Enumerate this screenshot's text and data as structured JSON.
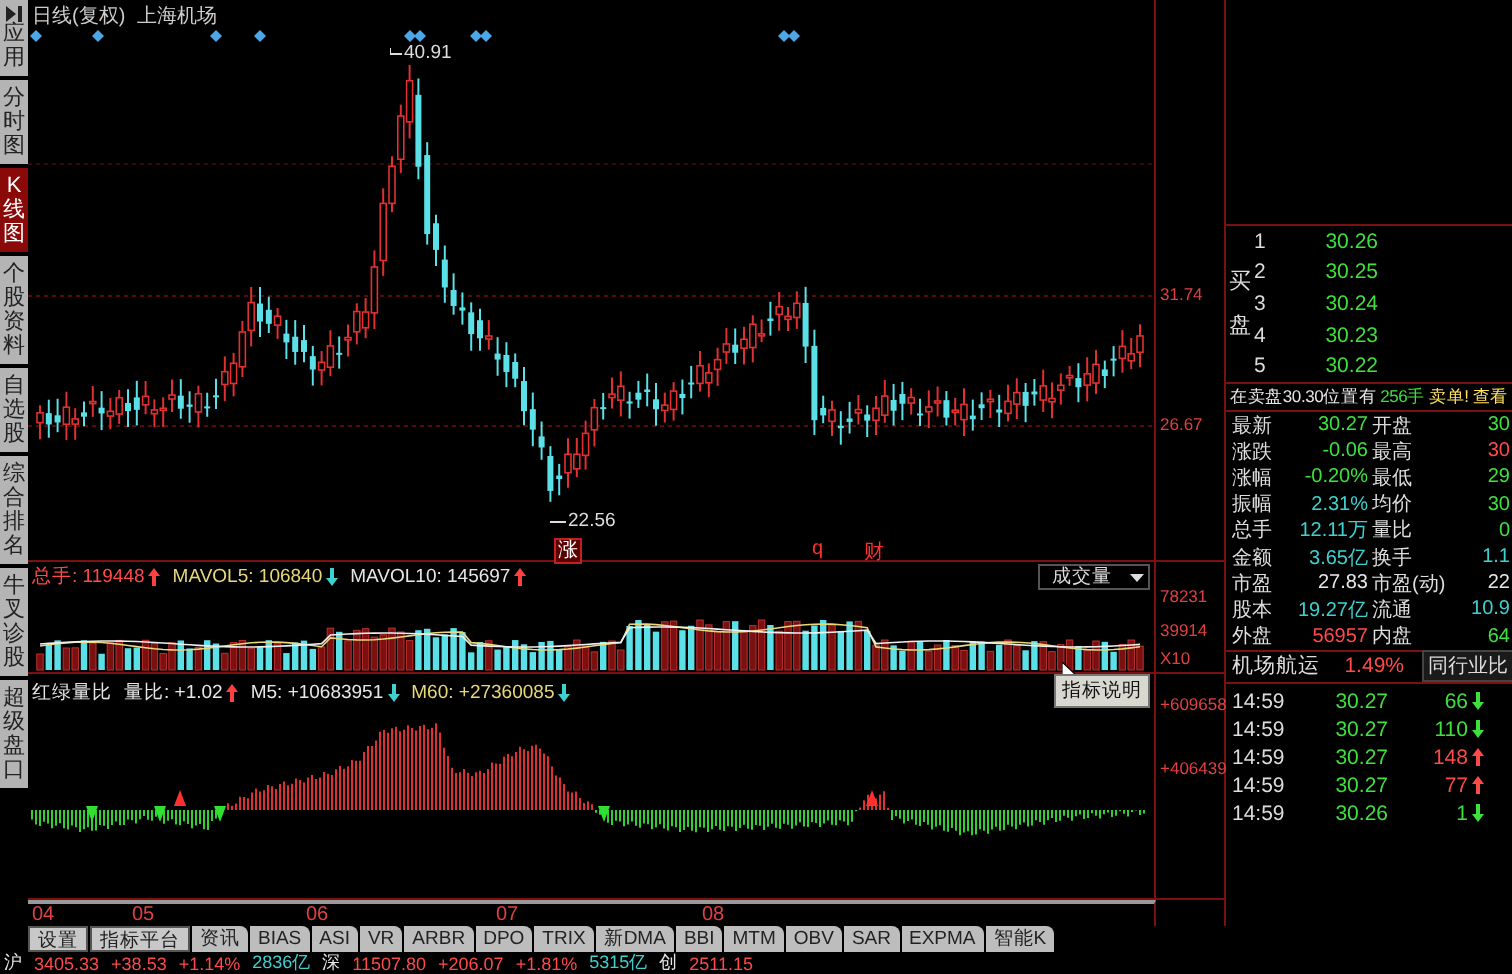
{
  "sidebar": {
    "items": [
      {
        "label": "应用",
        "selected": false,
        "kind": "menu"
      },
      {
        "label": "分时图",
        "selected": false,
        "kind": "tab"
      },
      {
        "label": "K线图",
        "selected": true,
        "kind": "tab"
      },
      {
        "label": "个股资料",
        "selected": false,
        "kind": "tab"
      },
      {
        "label": "自选股",
        "selected": false,
        "kind": "tab"
      },
      {
        "label": "综合排名",
        "selected": false,
        "kind": "tab"
      },
      {
        "label": "牛叉诊股",
        "selected": false,
        "kind": "tab"
      },
      {
        "label": "超级盘口",
        "selected": false,
        "kind": "tab"
      }
    ]
  },
  "kline": {
    "period": "日线(复权)",
    "stock": "上海机场",
    "high_label": "40.91",
    "low_label": "22.56",
    "event_marks": [
      "涨",
      "q",
      "财"
    ],
    "axis_labels": [
      "31.74",
      "26.67"
    ]
  },
  "volume": {
    "metrics": [
      {
        "label": "总手:",
        "value": "119448",
        "rising": true,
        "color": "#ff4a4a"
      },
      {
        "label": "MAVOL5:",
        "value": "106840",
        "rising": false,
        "color": "#e8d87a"
      },
      {
        "label": "MAVOL10:",
        "value": "145697",
        "rising": true,
        "color": "#e6e6e6"
      }
    ],
    "selector": "成交量",
    "axis_labels": [
      "78231",
      "39914",
      "X10"
    ],
    "tooltip": "指标说明"
  },
  "indicator": {
    "name": "红绿量比",
    "metrics": [
      {
        "label": "量比:",
        "value": "+1.02",
        "rising": true,
        "color": "#e6e6e6"
      },
      {
        "label": "M5:",
        "value": "+10683951",
        "rising": false,
        "color": "#e6e6e6"
      },
      {
        "label": "M60:",
        "value": "+27360085",
        "rising": false,
        "color": "#e8d87a"
      }
    ],
    "axis_labels": [
      "+609658",
      "+406439"
    ]
  },
  "date_axis": [
    "04",
    "05",
    "06",
    "07",
    "08"
  ],
  "tabs": [
    {
      "label": "设置",
      "kind": "button"
    },
    {
      "label": "指标平台",
      "kind": "button"
    },
    {
      "label": "资讯",
      "kind": "tab"
    },
    {
      "label": "BIAS",
      "kind": "tab"
    },
    {
      "label": "ASI",
      "kind": "tab"
    },
    {
      "label": "VR",
      "kind": "tab"
    },
    {
      "label": "ARBR",
      "kind": "tab"
    },
    {
      "label": "DPO",
      "kind": "tab"
    },
    {
      "label": "TRIX",
      "kind": "tab"
    },
    {
      "label": "新DMA",
      "kind": "tab"
    },
    {
      "label": "BBI",
      "kind": "tab"
    },
    {
      "label": "MTM",
      "kind": "tab"
    },
    {
      "label": "OBV",
      "kind": "tab"
    },
    {
      "label": "SAR",
      "kind": "tab"
    },
    {
      "label": "EXPMA",
      "kind": "tab"
    },
    {
      "label": "智能K",
      "kind": "tab"
    }
  ],
  "order_book": {
    "side_label": "买盘",
    "levels": [
      {
        "level": "1",
        "price": "30.26"
      },
      {
        "level": "2",
        "price": "30.25"
      },
      {
        "level": "3",
        "price": "30.24"
      },
      {
        "level": "4",
        "price": "30.23"
      },
      {
        "level": "5",
        "price": "30.22"
      }
    ]
  },
  "notice": {
    "text": "在卖盘30.30位置有",
    "lots": "256手",
    "alert": "卖单! 查看"
  },
  "quote": [
    {
      "label": "最新",
      "value": "30.27",
      "color": "#3ee03e"
    },
    {
      "label": "开盘",
      "value": "30",
      "color": "#3ee03e"
    },
    {
      "label": "涨跌",
      "value": "-0.06",
      "color": "#3ee03e"
    },
    {
      "label": "最高",
      "value": "30",
      "color": "#ff4a4a"
    },
    {
      "label": "涨幅",
      "value": "-0.20%",
      "color": "#3ee03e"
    },
    {
      "label": "最低",
      "value": "29",
      "color": "#3ee03e"
    },
    {
      "label": "振幅",
      "value": "2.31%",
      "color": "#3fd0d0"
    },
    {
      "label": "均价",
      "value": "30",
      "color": "#3ee03e"
    },
    {
      "label": "总手",
      "value": "12.11万",
      "color": "#3fd0d0"
    },
    {
      "label": "量比",
      "value": "0",
      "color": "#3ee03e"
    },
    {
      "label": "金额",
      "value": "3.65亿",
      "color": "#3fd0d0"
    },
    {
      "label": "换手",
      "value": "1.1",
      "color": "#3fd0d0"
    },
    {
      "label": "市盈",
      "value": "27.83",
      "color": "#e6e6e6"
    },
    {
      "label": "市盈(动)",
      "value": "22",
      "color": "#e6e6e6"
    },
    {
      "label": "股本",
      "value": "19.27亿",
      "color": "#3fd0d0"
    },
    {
      "label": "流通",
      "value": "10.9",
      "color": "#3fd0d0"
    },
    {
      "label": "外盘",
      "value": "56957",
      "color": "#ff4a4a"
    },
    {
      "label": "内盘",
      "value": "64",
      "color": "#3ee03e"
    }
  ],
  "sector": {
    "name": "机场航运",
    "change": "1.49%",
    "rising": true,
    "compare": "同行业比"
  },
  "ticks": [
    {
      "time": "14:59",
      "price": "30.27",
      "volume": "66",
      "rising": false
    },
    {
      "time": "14:59",
      "price": "30.27",
      "volume": "110",
      "rising": false
    },
    {
      "time": "14:59",
      "price": "30.27",
      "volume": "148",
      "rising": true
    },
    {
      "time": "14:59",
      "price": "30.27",
      "volume": "77",
      "rising": true
    },
    {
      "time": "14:59",
      "price": "30.26",
      "volume": "1",
      "rising": false
    }
  ],
  "status_bar": [
    {
      "text": "沪",
      "color": "#e6e6e6"
    },
    {
      "text": "3405.33",
      "color": "#ff4a4a"
    },
    {
      "text": "+38.53",
      "color": "#ff4a4a"
    },
    {
      "text": "+1.14%",
      "color": "#ff4a4a"
    },
    {
      "text": "2836亿",
      "color": "#3fd0d0"
    },
    {
      "text": "深",
      "color": "#e6e6e6"
    },
    {
      "text": "11507.80",
      "color": "#ff4a4a"
    },
    {
      "text": "+206.07",
      "color": "#ff4a4a"
    },
    {
      "text": "+1.81%",
      "color": "#ff4a4a"
    },
    {
      "text": "5315亿",
      "color": "#3fd0d0"
    },
    {
      "text": "创",
      "color": "#e6e6e6"
    },
    {
      "text": "2511.15",
      "color": "#ff4a4a"
    }
  ]
}
